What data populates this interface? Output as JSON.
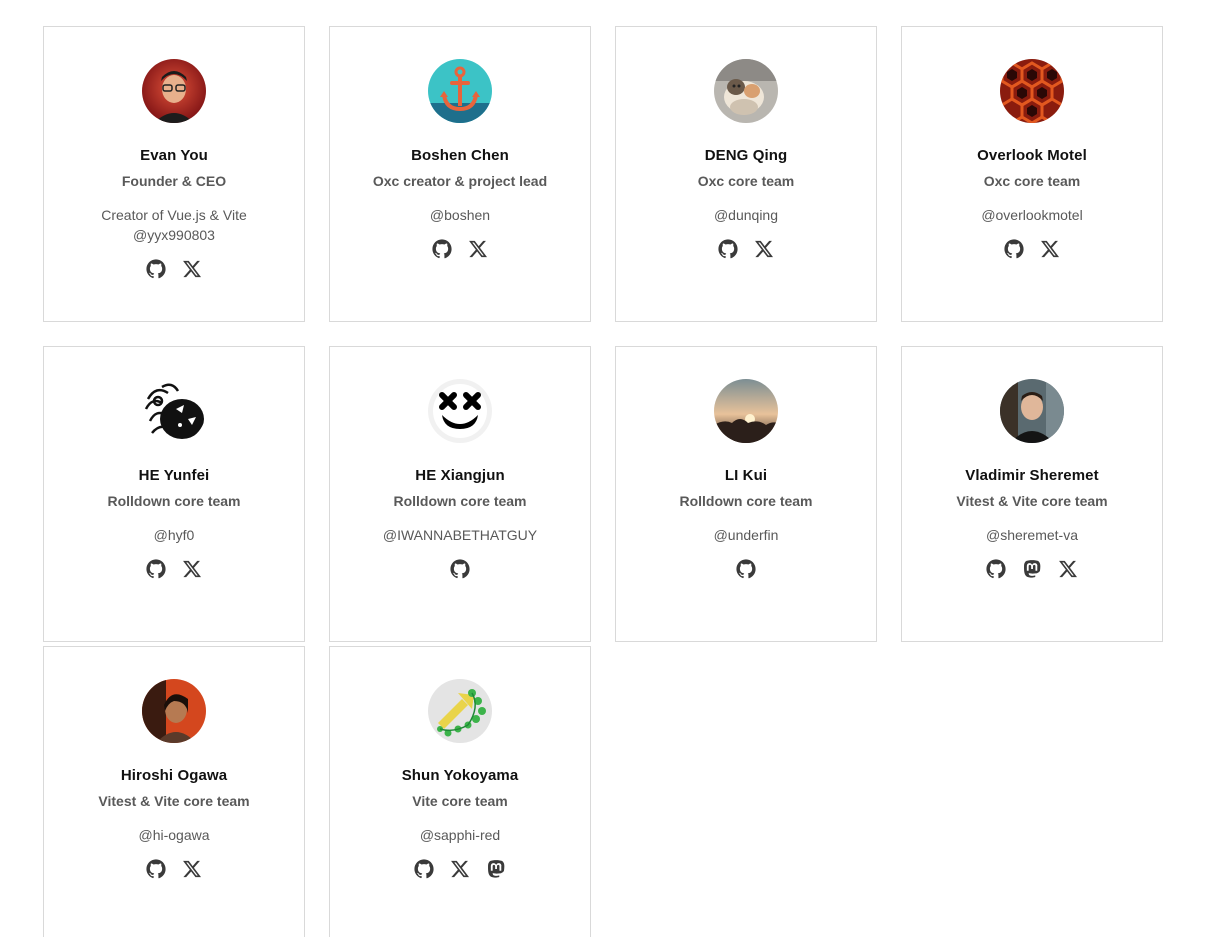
{
  "members": [
    {
      "name": "Evan You",
      "role": "Founder & CEO",
      "lines": [
        "Creator of Vue.js & Vite",
        "@yyx990803"
      ],
      "socials": [
        "github",
        "x"
      ]
    },
    {
      "name": "Boshen Chen",
      "role": "Oxc creator & project lead",
      "lines": [
        "@boshen"
      ],
      "socials": [
        "github",
        "x"
      ]
    },
    {
      "name": "DENG Qing",
      "role": "Oxc core team",
      "lines": [
        "@dunqing"
      ],
      "socials": [
        "github",
        "x"
      ]
    },
    {
      "name": "Overlook Motel",
      "role": "Oxc core team",
      "lines": [
        "@overlookmotel"
      ],
      "socials": [
        "github",
        "x"
      ]
    },
    {
      "name": "HE Yunfei",
      "role": "Rolldown core team",
      "lines": [
        "@hyf0"
      ],
      "socials": [
        "github",
        "x"
      ]
    },
    {
      "name": "HE Xiangjun",
      "role": "Rolldown core team",
      "lines": [
        "@IWANNABETHATGUY"
      ],
      "socials": [
        "github"
      ]
    },
    {
      "name": "LI Kui",
      "role": "Rolldown core team",
      "lines": [
        "@underfin"
      ],
      "socials": [
        "github"
      ]
    },
    {
      "name": "Vladimir Sheremet",
      "role": "Vitest & Vite core team",
      "lines": [
        "@sheremet-va"
      ],
      "socials": [
        "github",
        "mastodon",
        "x"
      ]
    },
    {
      "name": "Hiroshi Ogawa",
      "role": "Vitest & Vite core team",
      "lines": [
        "@hi-ogawa"
      ],
      "socials": [
        "github",
        "x"
      ]
    },
    {
      "name": "Shun Yokoyama",
      "role": "Vite core team",
      "lines": [
        "@sapphi-red"
      ],
      "socials": [
        "github",
        "x",
        "mastodon"
      ]
    }
  ],
  "icons": {
    "github": "github-icon",
    "x": "x-icon",
    "mastodon": "mastodon-icon"
  },
  "colors": {
    "card_border": "#d9d9d9",
    "name": "#111111",
    "muted": "#595959",
    "icon": "#3a3a3a"
  }
}
